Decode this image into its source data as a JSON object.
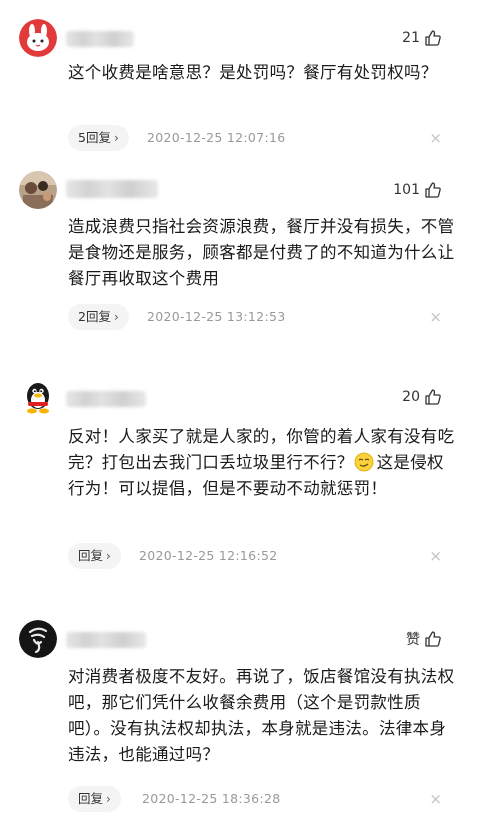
{
  "comments": [
    {
      "likes": "21",
      "text": "这个收费是啥意思？是处罚吗？餐厅有处罚权吗？",
      "reply_label": "5回复",
      "timestamp": "2020-12-25 12:07:16"
    },
    {
      "likes": "101",
      "text": "造成浪费只指社会资源浪费，餐厅并没有损失，不管是食物还是服务，顾客都是付费了的不知道为什么让餐厅再收取这个费用",
      "reply_label": "2回复",
      "timestamp": "2020-12-25 13:12:53"
    },
    {
      "likes": "20",
      "text_before_emoji": "反对！人家买了就是人家的，你管的着人家有没有吃完？打包出去我门口丢垃圾里行不行？",
      "text_after_emoji": "这是侵权行为！可以提倡，但是不要动不动就惩罚！",
      "reply_label": "回复",
      "timestamp": "2020-12-25 12:16:52"
    },
    {
      "likes": "赞",
      "text": "对消费者极度不友好。再说了，饭店餐馆没有执法权吧，那它们凭什么收餐余费用（这个是罚款性质吧）。没有执法权却执法，本身就是违法。法律本身违法，也能通过吗？",
      "reply_label": "回复",
      "timestamp": "2020-12-25 18:36:28"
    }
  ],
  "icons": {
    "chevron": "›",
    "close": "×"
  }
}
